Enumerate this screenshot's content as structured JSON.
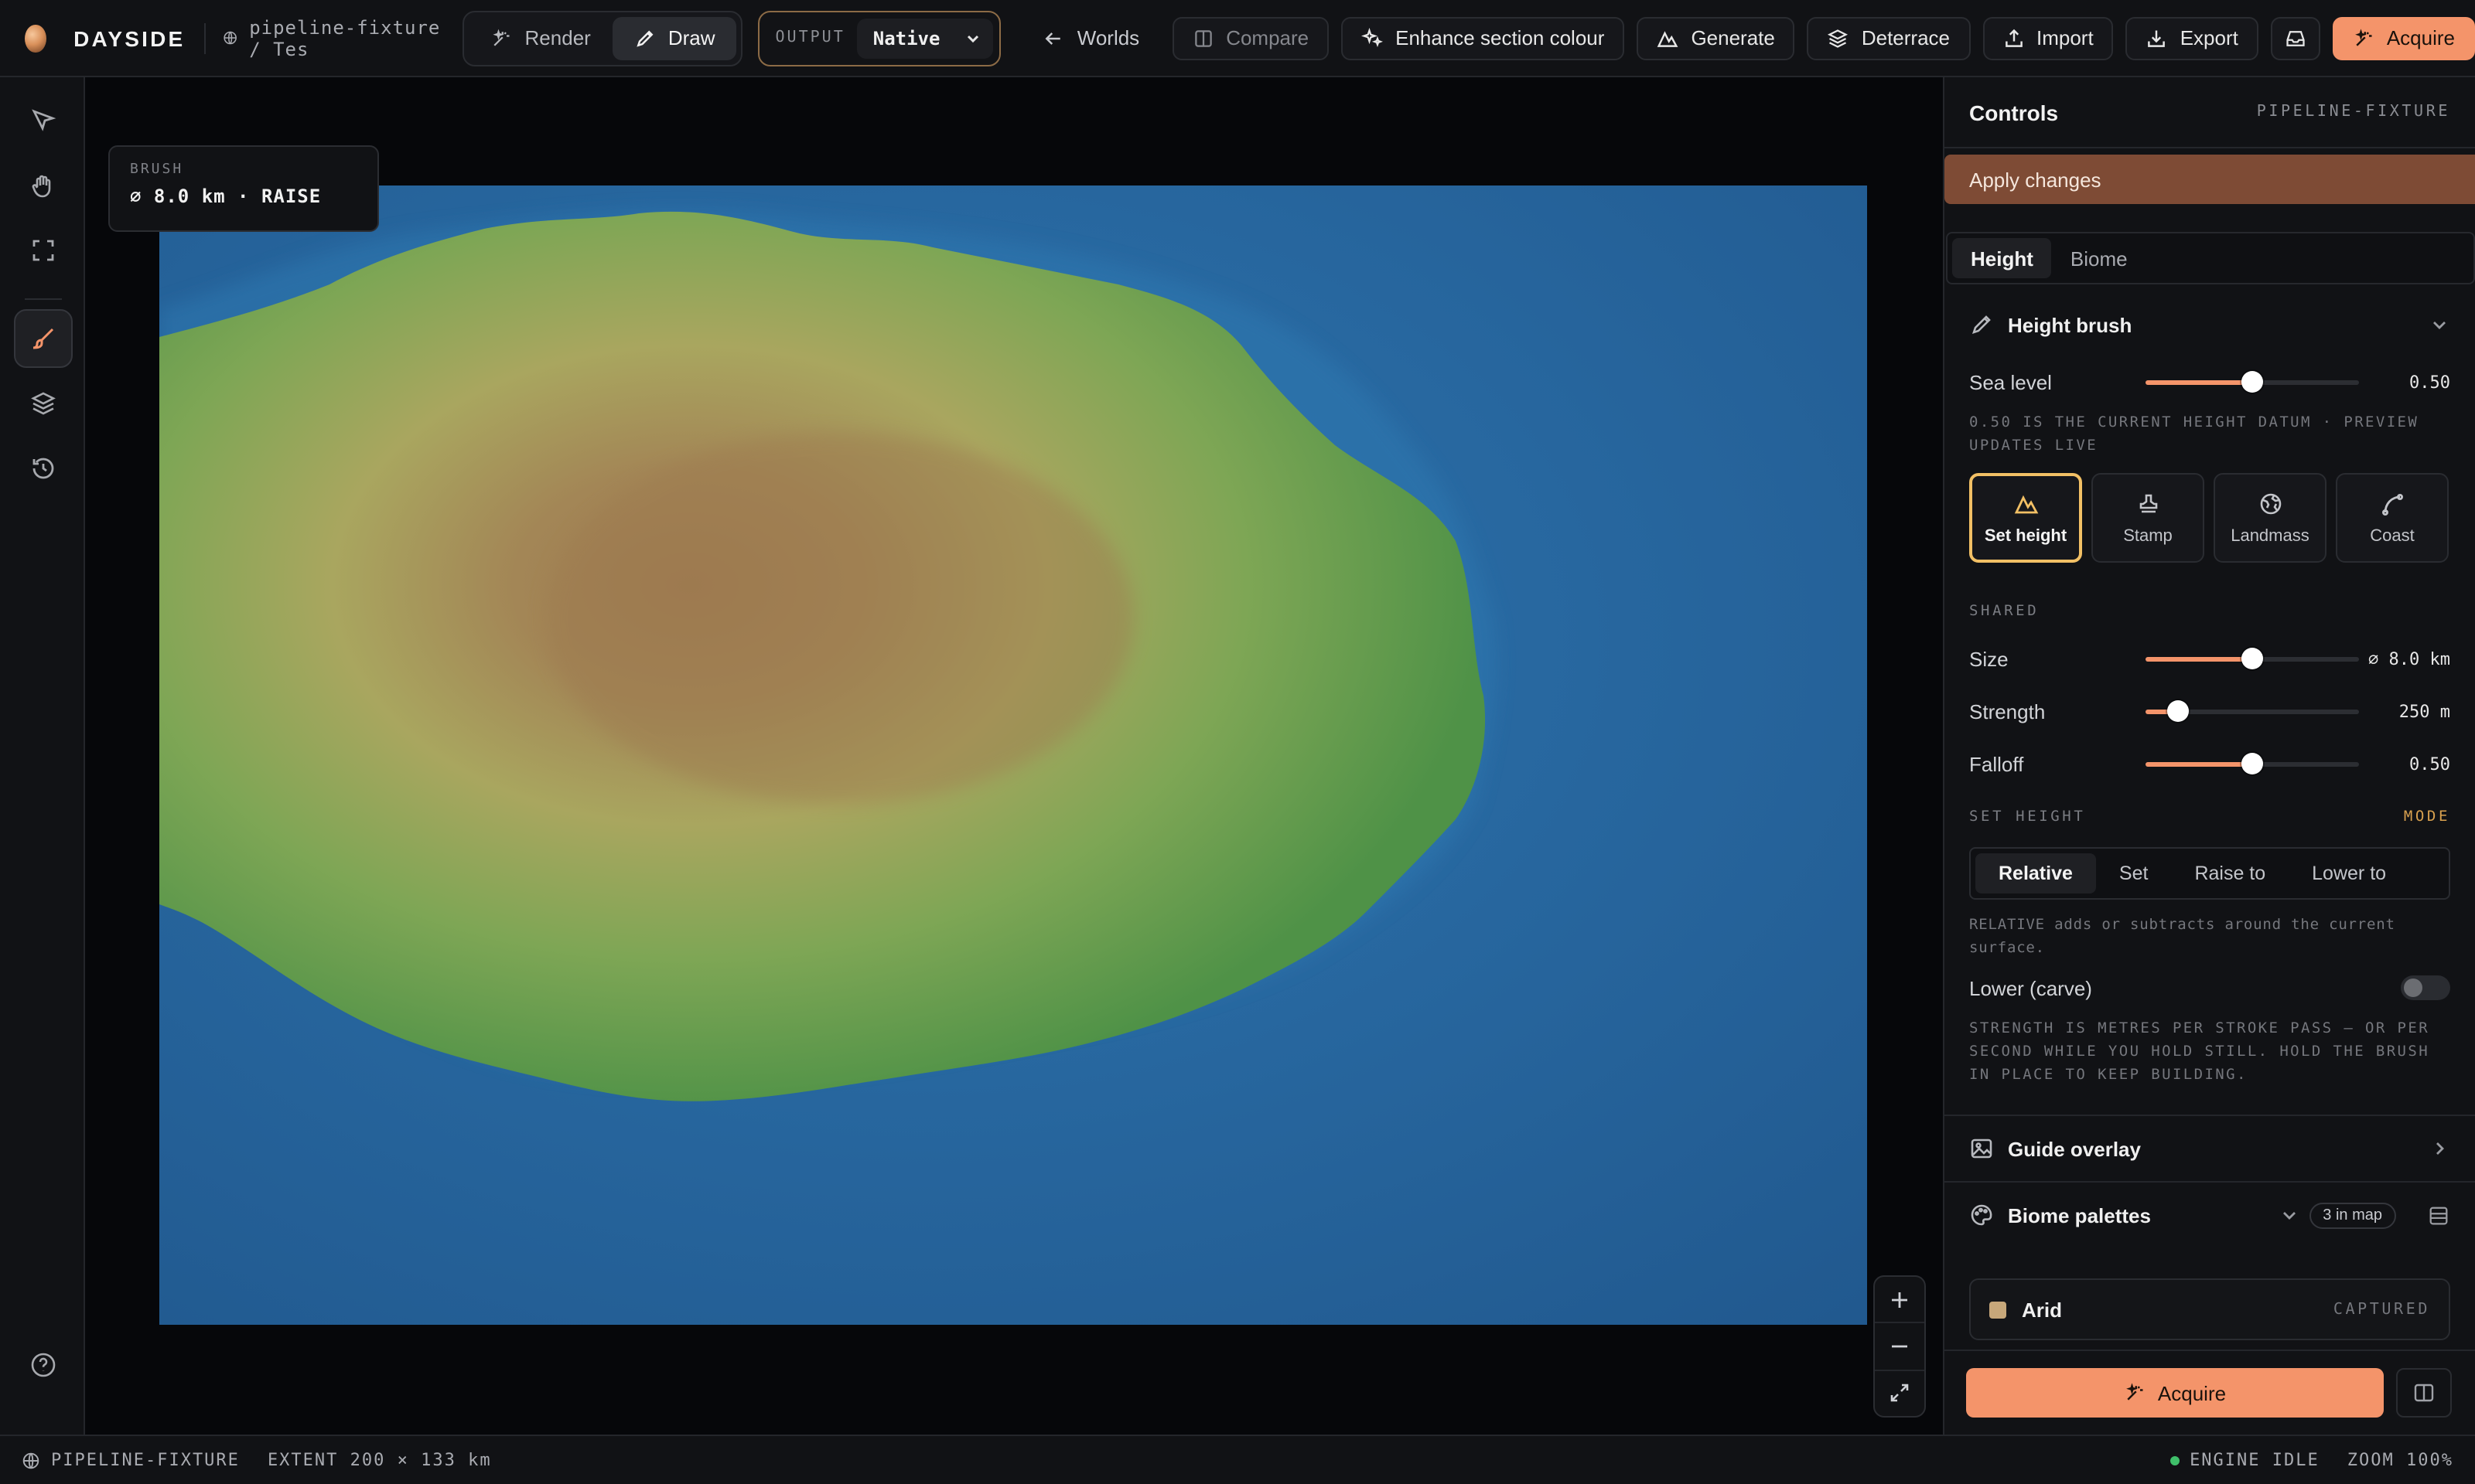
{
  "app": {
    "brand": "DAYSIDE",
    "breadcrumb": "pipeline-fixture / Tes"
  },
  "topbar": {
    "render_label": "Render",
    "draw_label": "Draw",
    "output_label": "OUTPUT",
    "output_value": "Native",
    "worlds_label": "Worlds",
    "compare_label": "Compare",
    "enhance_label": "Enhance section colour",
    "generate_label": "Generate",
    "deterrace_label": "Deterrace",
    "import_label": "Import",
    "export_label": "Export",
    "acquire_label": "Acquire"
  },
  "canvas": {
    "brush_caption": "BRUSH",
    "brush_value": "⌀ 8.0 km · RAISE"
  },
  "panel": {
    "title": "Controls",
    "project": "PIPELINE-FIXTURE",
    "apply_label": "Apply changes",
    "tabs": [
      "Height",
      "Biome"
    ],
    "height_brush": {
      "title": "Height brush",
      "sea_level_label": "Sea level",
      "sea_level_value": "0.50",
      "sea_level": 0.5,
      "sea_hint": "0.50 IS THE CURRENT HEIGHT DATUM · PREVIEW UPDATES LIVE",
      "tools": [
        "Set height",
        "Stamp",
        "Landmass",
        "Coast"
      ],
      "shared_caption": "SHARED",
      "size_label": "Size",
      "size_value": "⌀ 8.0 km",
      "size": 0.5,
      "strength_label": "Strength",
      "strength_value": "250 m",
      "strength": 0.15,
      "falloff_label": "Falloff",
      "falloff_value": "0.50",
      "falloff": 0.5,
      "set_height_caption": "SET HEIGHT",
      "mode_caption": "MODE",
      "modes": [
        "Relative",
        "Set",
        "Raise to",
        "Lower to"
      ],
      "relative_hint": "RELATIVE adds or subtracts around the current surface.",
      "lower_label": "Lower (carve)",
      "strength_hint": "STRENGTH IS METRES PER STROKE PASS — OR PER SECOND WHILE YOU HOLD STILL. HOLD THE BRUSH IN PLACE TO KEEP BUILDING."
    },
    "guide_overlay_label": "Guide overlay",
    "biome_palettes_label": "Biome palettes",
    "biome_count": "3 in map",
    "palette_item": {
      "name": "Arid",
      "state": "CAPTURED",
      "color": "#c7a77a"
    },
    "acquire_label": "Acquire"
  },
  "status": {
    "project": "PIPELINE-FIXTURE",
    "extent": "EXTENT 200 × 133 km",
    "engine": "ENGINE IDLE",
    "zoom": "ZOOM 100%"
  },
  "colors": {
    "accent": "#f4946a",
    "ocean": "#2a6aa3",
    "land_low": "#5a9a4a",
    "land_mid": "#a8ad62",
    "land_high": "#a07d52"
  }
}
